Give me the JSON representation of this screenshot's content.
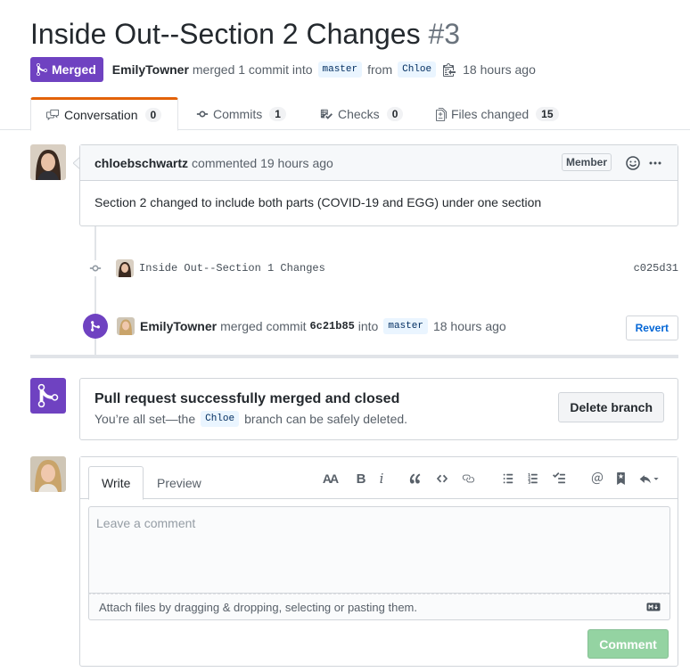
{
  "pr": {
    "title": "Inside Out--Section 2 Changes",
    "number": "#3",
    "status": "Merged",
    "author": "EmilyTowner",
    "merge_text": "merged 1 commit into",
    "base_branch": "master",
    "from_text": "from",
    "head_branch": "Chloe",
    "time": "18 hours ago"
  },
  "tabs": [
    {
      "label": "Conversation",
      "count": "0"
    },
    {
      "label": "Commits",
      "count": "1"
    },
    {
      "label": "Checks",
      "count": "0"
    },
    {
      "label": "Files changed",
      "count": "15"
    }
  ],
  "comment": {
    "author": "chloebschwartz",
    "action": "commented 19 hours ago",
    "role": "Member",
    "body": "Section 2 changed to include both parts (COVID-19 and EGG) under one section"
  },
  "commit": {
    "message": "Inside Out--Section 1 Changes",
    "sha": "c025d31"
  },
  "merge_event": {
    "author": "EmilyTowner",
    "text": "merged commit",
    "sha": "6c21b85",
    "into_text": "into",
    "branch": "master",
    "time": "18 hours ago",
    "revert_label": "Revert"
  },
  "merged_box": {
    "title": "Pull request successfully merged and closed",
    "sub_before": "You’re all set—the",
    "branch": "Chloe",
    "sub_after": "branch can be safely deleted.",
    "delete_label": "Delete branch"
  },
  "form": {
    "write_tab": "Write",
    "preview_tab": "Preview",
    "placeholder": "Leave a comment",
    "attach_text": "Attach files by dragging & dropping, selecting or pasting them.",
    "submit_label": "Comment"
  },
  "colors": {
    "merged": "#6f42c1",
    "link": "#0366d6",
    "submit_disabled": "#94d3a2"
  }
}
